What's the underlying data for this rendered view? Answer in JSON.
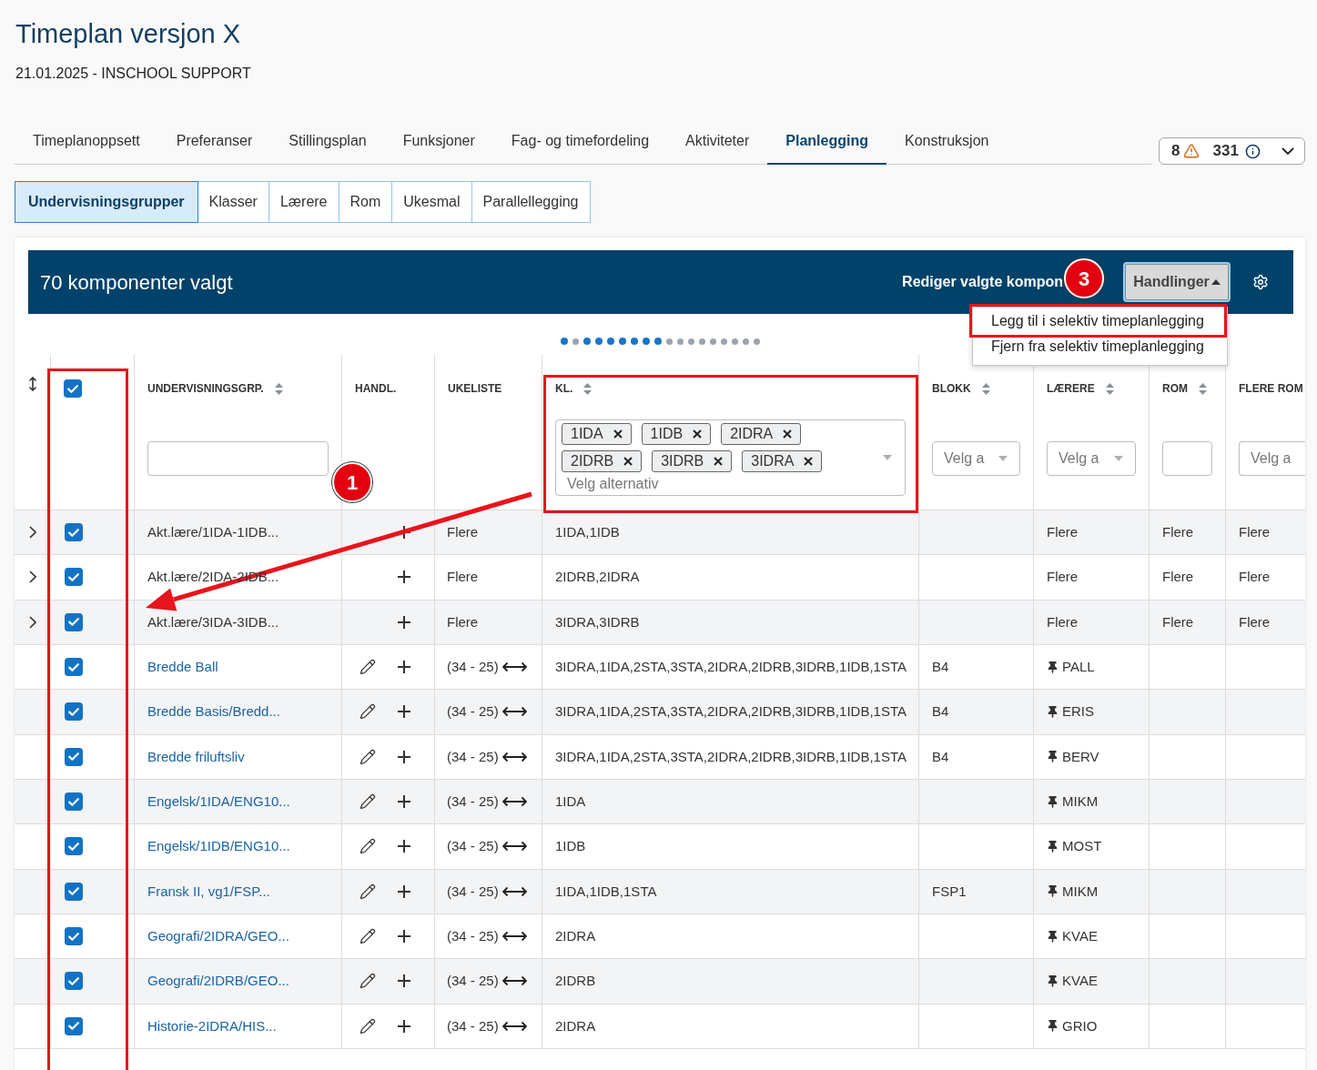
{
  "page": {
    "title": "Timeplan versjon X",
    "subtitle": "21.01.2025 - INSCHOOL SUPPORT"
  },
  "tabs": [
    {
      "label": "Timeplanoppsett",
      "selected": false
    },
    {
      "label": "Preferanser",
      "selected": false
    },
    {
      "label": "Stillingsplan",
      "selected": false
    },
    {
      "label": "Funksjoner",
      "selected": false
    },
    {
      "label": "Fag- og timefordeling",
      "selected": false
    },
    {
      "label": "Aktiviteter",
      "selected": false
    },
    {
      "label": "Planlegging",
      "selected": true
    },
    {
      "label": "Konstruksjon",
      "selected": false
    }
  ],
  "status_summary": {
    "warnings": "8",
    "notices": "331"
  },
  "subtabs": [
    {
      "label": "Undervisningsgrupper",
      "selected": true
    },
    {
      "label": "Klasser",
      "selected": false
    },
    {
      "label": "Lærere",
      "selected": false
    },
    {
      "label": "Rom",
      "selected": false
    },
    {
      "label": "Ukesmal",
      "selected": false
    },
    {
      "label": "Parallellegging",
      "selected": false
    }
  ],
  "selection_bar": {
    "title": "70 komponenter valgt",
    "edit_link": "Rediger valgte kompon",
    "actions_button": {
      "label": "Handlinger",
      "expanded": true
    }
  },
  "actions_menu": [
    {
      "label": "Legg til i selektiv timeplanlegging"
    },
    {
      "label": "Fjern fra selektiv timeplanlegging"
    }
  ],
  "pager_dots": [
    {
      "active": true
    },
    {
      "active": false
    },
    {
      "active": true
    },
    {
      "active": true
    },
    {
      "active": true
    },
    {
      "active": true
    },
    {
      "active": true
    },
    {
      "active": true
    },
    {
      "active": true
    },
    {
      "active": false
    },
    {
      "active": false
    },
    {
      "active": false
    },
    {
      "active": false
    },
    {
      "active": false
    },
    {
      "active": false
    },
    {
      "active": false
    },
    {
      "active": false
    },
    {
      "active": false
    }
  ],
  "table": {
    "select_all_checked": true,
    "columns": [
      {
        "label": "UNDERVISNINGSGRP.",
        "sortable": true,
        "filter": {
          "kind": "text"
        }
      },
      {
        "label": "HANDL.",
        "sortable": false
      },
      {
        "label": "UKELISTE",
        "sortable": false
      },
      {
        "label": "KL.",
        "sortable": true,
        "filter": {
          "kind": "multiselect",
          "chips": [
            "1IDA",
            "1IDB",
            "2IDRA",
            "2IDRB",
            "3IDRB",
            "3IDRA"
          ],
          "placeholder": "Velg alternativ"
        }
      },
      {
        "label": "BLOKK",
        "sortable": true,
        "filter": {
          "kind": "select",
          "placeholder": "Velg a"
        }
      },
      {
        "label": "LÆRERE",
        "sortable": true,
        "filter": {
          "kind": "select",
          "placeholder": "Velg a"
        }
      },
      {
        "label": "ROM",
        "sortable": true,
        "filter": {
          "kind": "text"
        }
      },
      {
        "label": "FLERE ROM",
        "sortable": false,
        "filter": {
          "kind": "select",
          "placeholder": "Velg a"
        }
      }
    ],
    "rows": [
      {
        "kind": "group",
        "checked": true,
        "name": "Akt.lære/1IDA-1IDB...",
        "week_list": "Flere",
        "classes": "1IDA,1IDB",
        "teachers": "Flere",
        "teacher_pinned": false,
        "rooms": "Flere",
        "extra_rooms": "Flere"
      },
      {
        "kind": "group",
        "checked": true,
        "name": "Akt.lære/2IDA-2IDB...",
        "week_list": "Flere",
        "classes": "2IDRB,2IDRA",
        "teachers": "Flere",
        "teacher_pinned": false,
        "rooms": "Flere",
        "extra_rooms": "Flere"
      },
      {
        "kind": "group",
        "checked": true,
        "name": "Akt.lære/3IDA-3IDB...",
        "week_list": "Flere",
        "classes": "3IDRA,3IDRB",
        "teachers": "Flere",
        "teacher_pinned": false,
        "rooms": "Flere",
        "extra_rooms": "Flere"
      },
      {
        "kind": "component",
        "checked": true,
        "name": "Bredde Ball",
        "week_list": "(34 - 25)",
        "classes": "3IDRA,1IDA,2STA,3STA,2IDRA,2IDRB,3IDRB,1IDB,1STA",
        "block": "B4",
        "teachers": "PALL",
        "teacher_pinned": true
      },
      {
        "kind": "component",
        "checked": true,
        "name": "Bredde Basis/Bredd...",
        "week_list": "(34 - 25)",
        "classes": "3IDRA,1IDA,2STA,3STA,2IDRA,2IDRB,3IDRB,1IDB,1STA",
        "block": "B4",
        "teachers": "ERIS",
        "teacher_pinned": true
      },
      {
        "kind": "component",
        "checked": true,
        "name": "Bredde friluftsliv",
        "week_list": "(34 - 25)",
        "classes": "3IDRA,1IDA,2STA,3STA,2IDRA,2IDRB,3IDRB,1IDB,1STA",
        "block": "B4",
        "teachers": "BERV",
        "teacher_pinned": true
      },
      {
        "kind": "component",
        "checked": true,
        "name": "Engelsk/1IDA/ENG10...",
        "week_list": "(34 - 25)",
        "classes": "1IDA",
        "teachers": "MIKM",
        "teacher_pinned": true
      },
      {
        "kind": "component",
        "checked": true,
        "name": "Engelsk/1IDB/ENG10...",
        "week_list": "(34 - 25)",
        "classes": "1IDB",
        "teachers": "MOST",
        "teacher_pinned": true
      },
      {
        "kind": "component",
        "checked": true,
        "name": "Fransk II, vg1/FSP...",
        "week_list": "(34 - 25)",
        "classes": "1IDA,1IDB,1STA",
        "block": "FSP1",
        "teachers": "MIKM",
        "teacher_pinned": true
      },
      {
        "kind": "component",
        "checked": true,
        "name": "Geografi/2IDRA/GEO...",
        "week_list": "(34 - 25)",
        "classes": "2IDRA",
        "teachers": "KVAE",
        "teacher_pinned": true
      },
      {
        "kind": "component",
        "checked": true,
        "name": "Geografi/2IDRB/GEO...",
        "week_list": "(34 - 25)",
        "classes": "2IDRB",
        "teachers": "KVAE",
        "teacher_pinned": true
      },
      {
        "kind": "component",
        "checked": true,
        "name": "Historie-2IDRA/HIS...",
        "week_list": "(34 - 25)",
        "classes": "2IDRA",
        "teachers": "GRIO",
        "teacher_pinned": true
      }
    ]
  },
  "callouts": [
    {
      "label": "1"
    },
    {
      "label": "3"
    }
  ]
}
